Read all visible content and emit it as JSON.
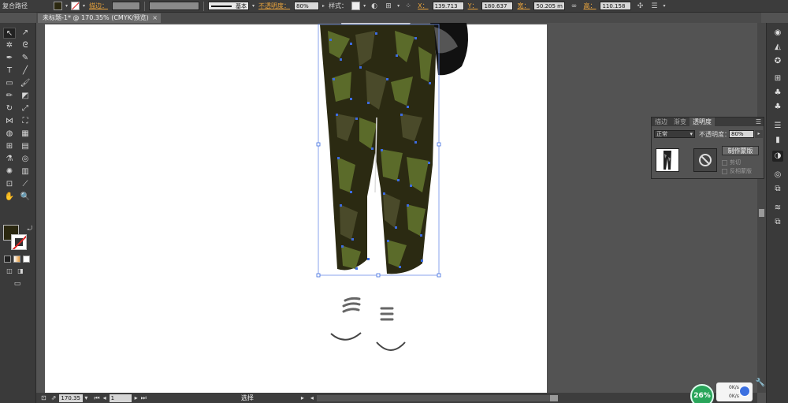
{
  "control_bar": {
    "object_type": "复合路径",
    "stroke_label": "描边：",
    "stroke_profile": "基本",
    "opacity_label": "不透明度：",
    "opacity_value": "80%",
    "style_label": "样式：",
    "x_label": "X：",
    "x_value": "139.713",
    "y_label": "Y：",
    "y_value": "180.637",
    "w_label": "宽：",
    "w_value": "50.205 m",
    "h_label": "高：",
    "h_value": "110.158"
  },
  "document_tab": {
    "title": "未标题-1* @ 170.35% (CMYK/预览)",
    "close": "×"
  },
  "colors": {
    "fill": "#2b2810",
    "camo_dark": "#2b2a12",
    "camo_mid": "#4a4a2a",
    "camo_olive": "#5b6b2a",
    "selection": "#3d6be0"
  },
  "transparency_panel": {
    "tabs": [
      "描边",
      "渐变",
      "透明度"
    ],
    "active_tab": "透明度",
    "blend_mode": "正常",
    "opacity_label": "不透明度：",
    "opacity_value": "80%",
    "make_mask": "制作蒙版",
    "clip": "剪切",
    "invert_mask": "反相蒙版"
  },
  "status_bar": {
    "zoom": "170.35",
    "page": "1",
    "mode": "选择"
  },
  "tray": {
    "percent": "26%",
    "up": "0K/s",
    "down": "0K/s"
  }
}
